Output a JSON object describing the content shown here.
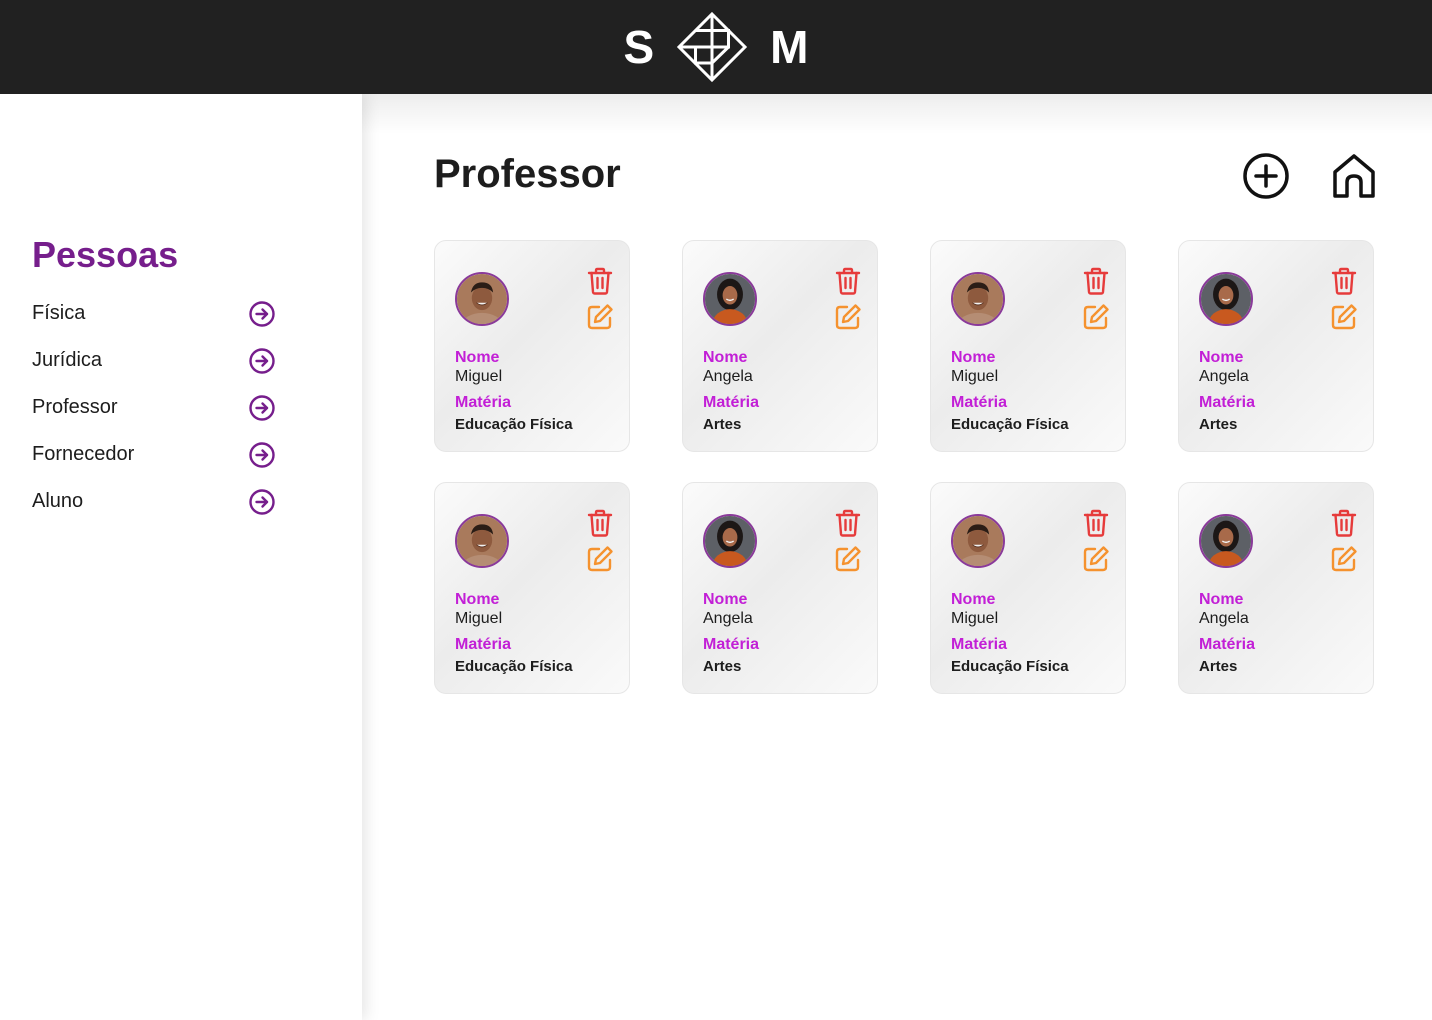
{
  "colors": {
    "header_bg": "#212121",
    "accent_purple": "#761e8c",
    "label_magenta": "#c21fd6",
    "delete_red": "#e63b3b",
    "edit_orange": "#f5922e"
  },
  "header": {
    "logo_left": "S",
    "logo_right": "M",
    "logo_icon": "diamond-logo-icon"
  },
  "sidebar": {
    "title": "Pessoas",
    "items": [
      {
        "label": "Física",
        "icon": "arrow-right-circle-icon"
      },
      {
        "label": "Jurídica",
        "icon": "arrow-right-circle-icon"
      },
      {
        "label": "Professor",
        "icon": "arrow-right-circle-icon"
      },
      {
        "label": "Fornecedor",
        "icon": "arrow-right-circle-icon"
      },
      {
        "label": "Aluno",
        "icon": "arrow-right-circle-icon"
      }
    ]
  },
  "main": {
    "title": "Professor",
    "actions": [
      {
        "icon": "plus-circle-icon"
      },
      {
        "icon": "home-icon"
      }
    ],
    "cards": [
      {
        "name_label": "Nome",
        "name": "Miguel",
        "subject_label": "Matéria",
        "subject": "Educação Física",
        "avatar": "male-avatar"
      },
      {
        "name_label": "Nome",
        "name": "Angela",
        "subject_label": "Matéria",
        "subject": "Artes",
        "avatar": "female-avatar"
      },
      {
        "name_label": "Nome",
        "name": "Miguel",
        "subject_label": "Matéria",
        "subject": "Educação Física",
        "avatar": "male-avatar"
      },
      {
        "name_label": "Nome",
        "name": "Angela",
        "subject_label": "Matéria",
        "subject": "Artes",
        "avatar": "female-avatar"
      },
      {
        "name_label": "Nome",
        "name": "Miguel",
        "subject_label": "Matéria",
        "subject": "Educação Física",
        "avatar": "male-avatar"
      },
      {
        "name_label": "Nome",
        "name": "Angela",
        "subject_label": "Matéria",
        "subject": "Artes",
        "avatar": "female-avatar"
      },
      {
        "name_label": "Nome",
        "name": "Miguel",
        "subject_label": "Matéria",
        "subject": "Educação Física",
        "avatar": "male-avatar"
      },
      {
        "name_label": "Nome",
        "name": "Angela",
        "subject_label": "Matéria",
        "subject": "Artes",
        "avatar": "female-avatar"
      }
    ]
  }
}
